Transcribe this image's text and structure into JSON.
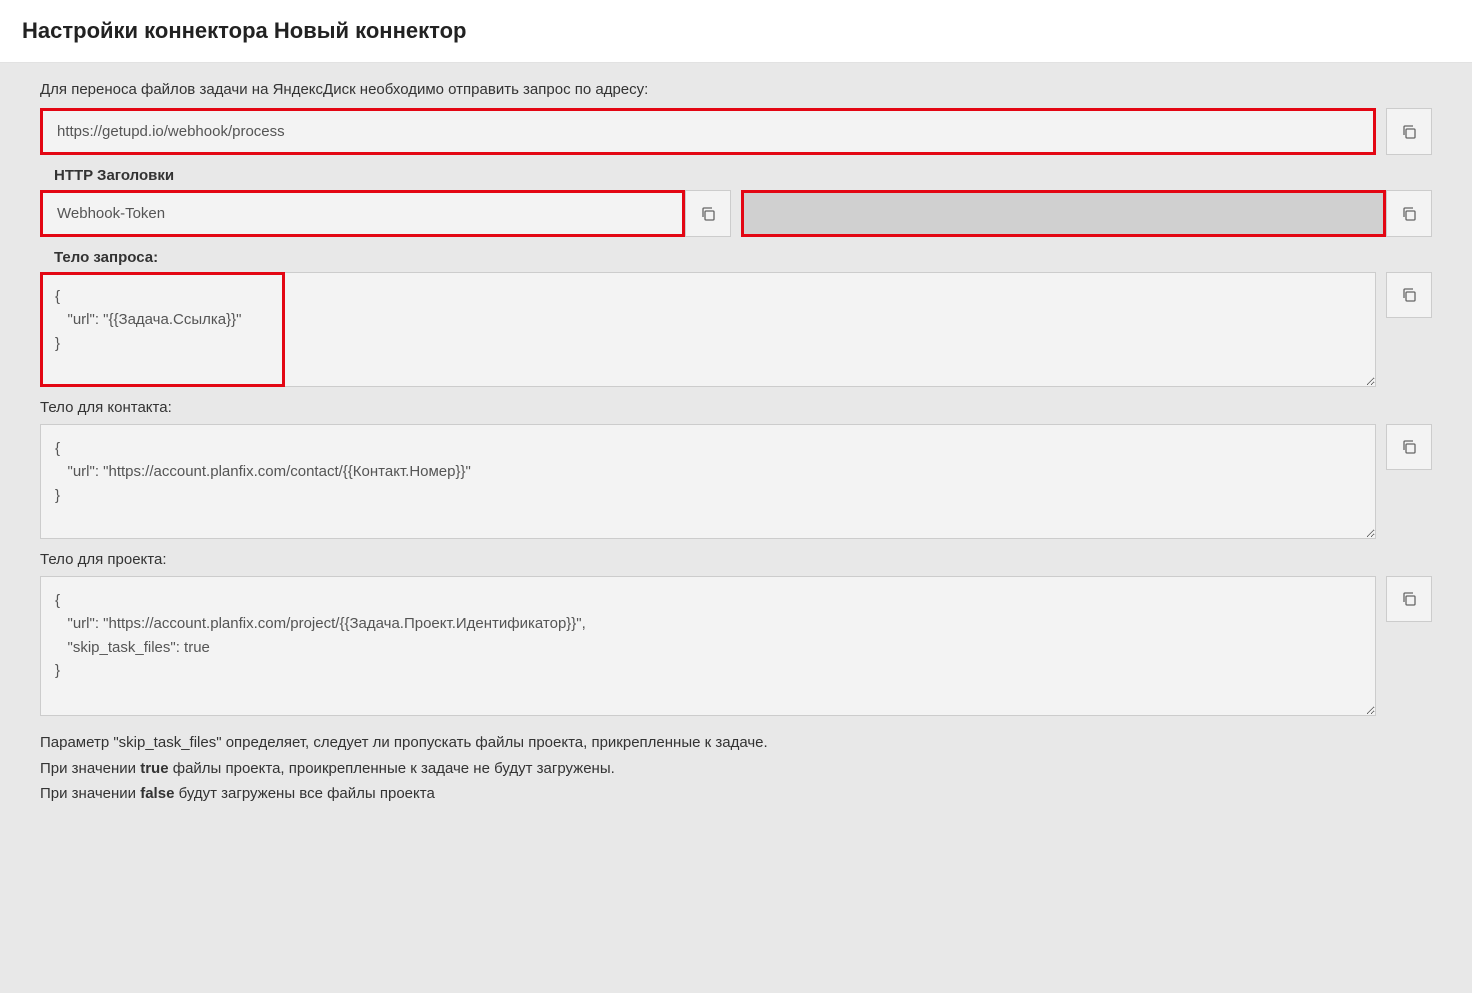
{
  "header": {
    "title": "Настройки коннектора Новый коннектор"
  },
  "intro": "Для переноса файлов задачи на ЯндексДиск необходимо отправить запрос по адресу:",
  "url_input": "https://getupd.io/webhook/process",
  "http_headers_label": "HTTP Заголовки",
  "header_key": "Webhook-Token",
  "header_value": "████████████████████████████████",
  "body_label": "Тело запроса:",
  "body_task": "{\n   \"url\": \"{{Задача.Ссылка}}\"\n}",
  "contact_label": "Тело для контакта:",
  "body_contact": "{\n   \"url\": \"https://account.planfix.com/contact/{{Контакт.Номер}}\"\n}",
  "project_label": "Тело для проекта:",
  "body_project": "{\n   \"url\": \"https://account.planfix.com/project/{{Задача.Проект.Идентификатор}}\",\n   \"skip_task_files\": true\n}",
  "footer": {
    "line1_a": "Параметр \"skip_task_files\" определяет, следует ли пропускать файлы проекта, прикрепленные к задаче.",
    "line2_a": "При значении ",
    "line2_b": "true",
    "line2_c": " файлы проекта, проикрепленные к задаче не будут загружены.",
    "line3_a": "При значении ",
    "line3_b": "false",
    "line3_c": " будут загружены все файлы проекта"
  }
}
